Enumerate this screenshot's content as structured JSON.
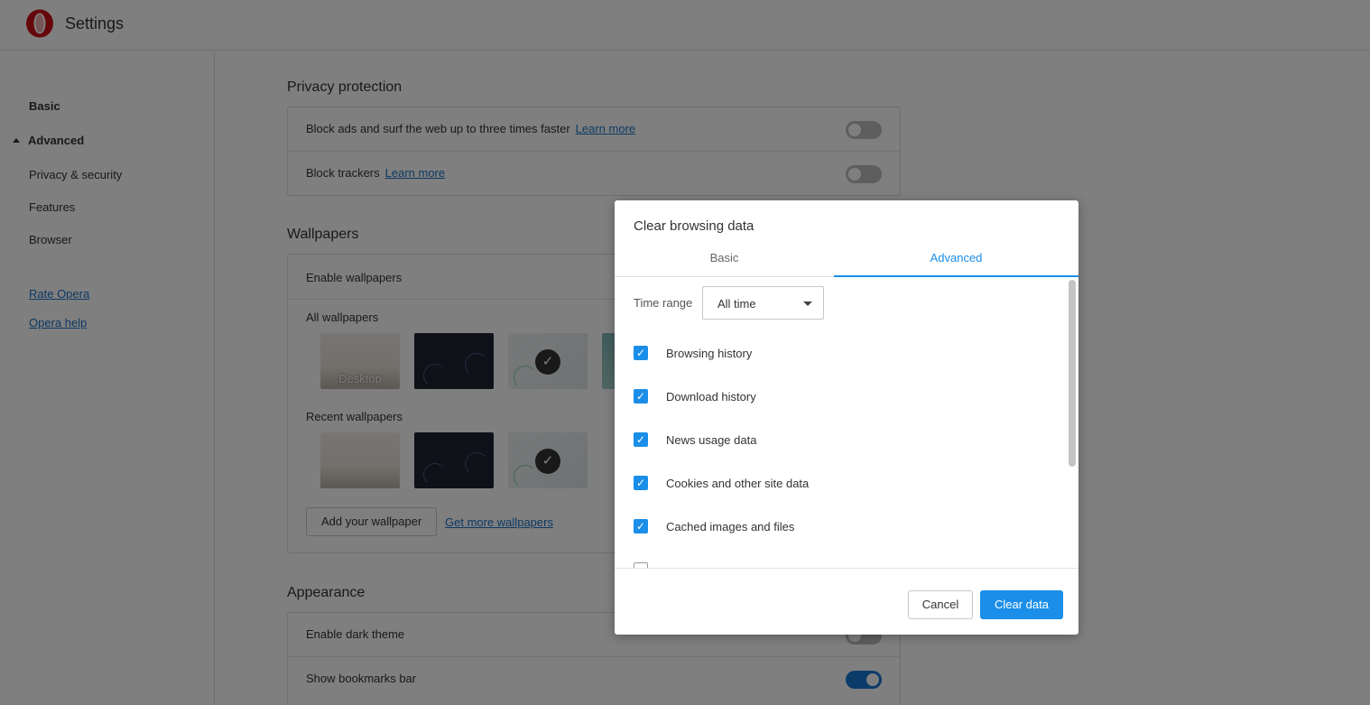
{
  "header": {
    "title": "Settings"
  },
  "sidebar": {
    "basic": "Basic",
    "advanced": "Advanced",
    "items": [
      "Privacy & security",
      "Features",
      "Browser"
    ],
    "links": [
      "Rate Opera",
      "Opera help"
    ]
  },
  "privacy": {
    "title": "Privacy protection",
    "rows": [
      {
        "text": "Block ads and surf the web up to three times faster",
        "link": "Learn more",
        "enabled": false
      },
      {
        "text": "Block trackers",
        "link": "Learn more",
        "enabled": false
      }
    ]
  },
  "wallpapers": {
    "title": "Wallpapers",
    "enable_label": "Enable wallpapers",
    "all_label": "All wallpapers",
    "recent_label": "Recent wallpapers",
    "desktop_label": "Desktop",
    "add_button": "Add your wallpaper",
    "more_link": "Get more wallpapers"
  },
  "appearance": {
    "title": "Appearance",
    "rows": [
      {
        "text": "Enable dark theme",
        "enabled": false
      },
      {
        "text": "Show bookmarks bar",
        "enabled": true
      }
    ]
  },
  "dialog": {
    "title": "Clear browsing data",
    "tabs": [
      "Basic",
      "Advanced"
    ],
    "active_tab": "Advanced",
    "time_range_label": "Time range",
    "time_range_value": "All time",
    "items": [
      {
        "label": "Browsing history",
        "checked": true
      },
      {
        "label": "Download history",
        "checked": true
      },
      {
        "label": "News usage data",
        "checked": true
      },
      {
        "label": "Cookies and other site data",
        "checked": true
      },
      {
        "label": "Cached images and files",
        "checked": true
      },
      {
        "label": "",
        "checked": false
      }
    ],
    "cancel": "Cancel",
    "confirm": "Clear data"
  },
  "colors": {
    "accent": "#1a8ee8",
    "link": "#1a73c8",
    "brand": "#cc0f16"
  }
}
